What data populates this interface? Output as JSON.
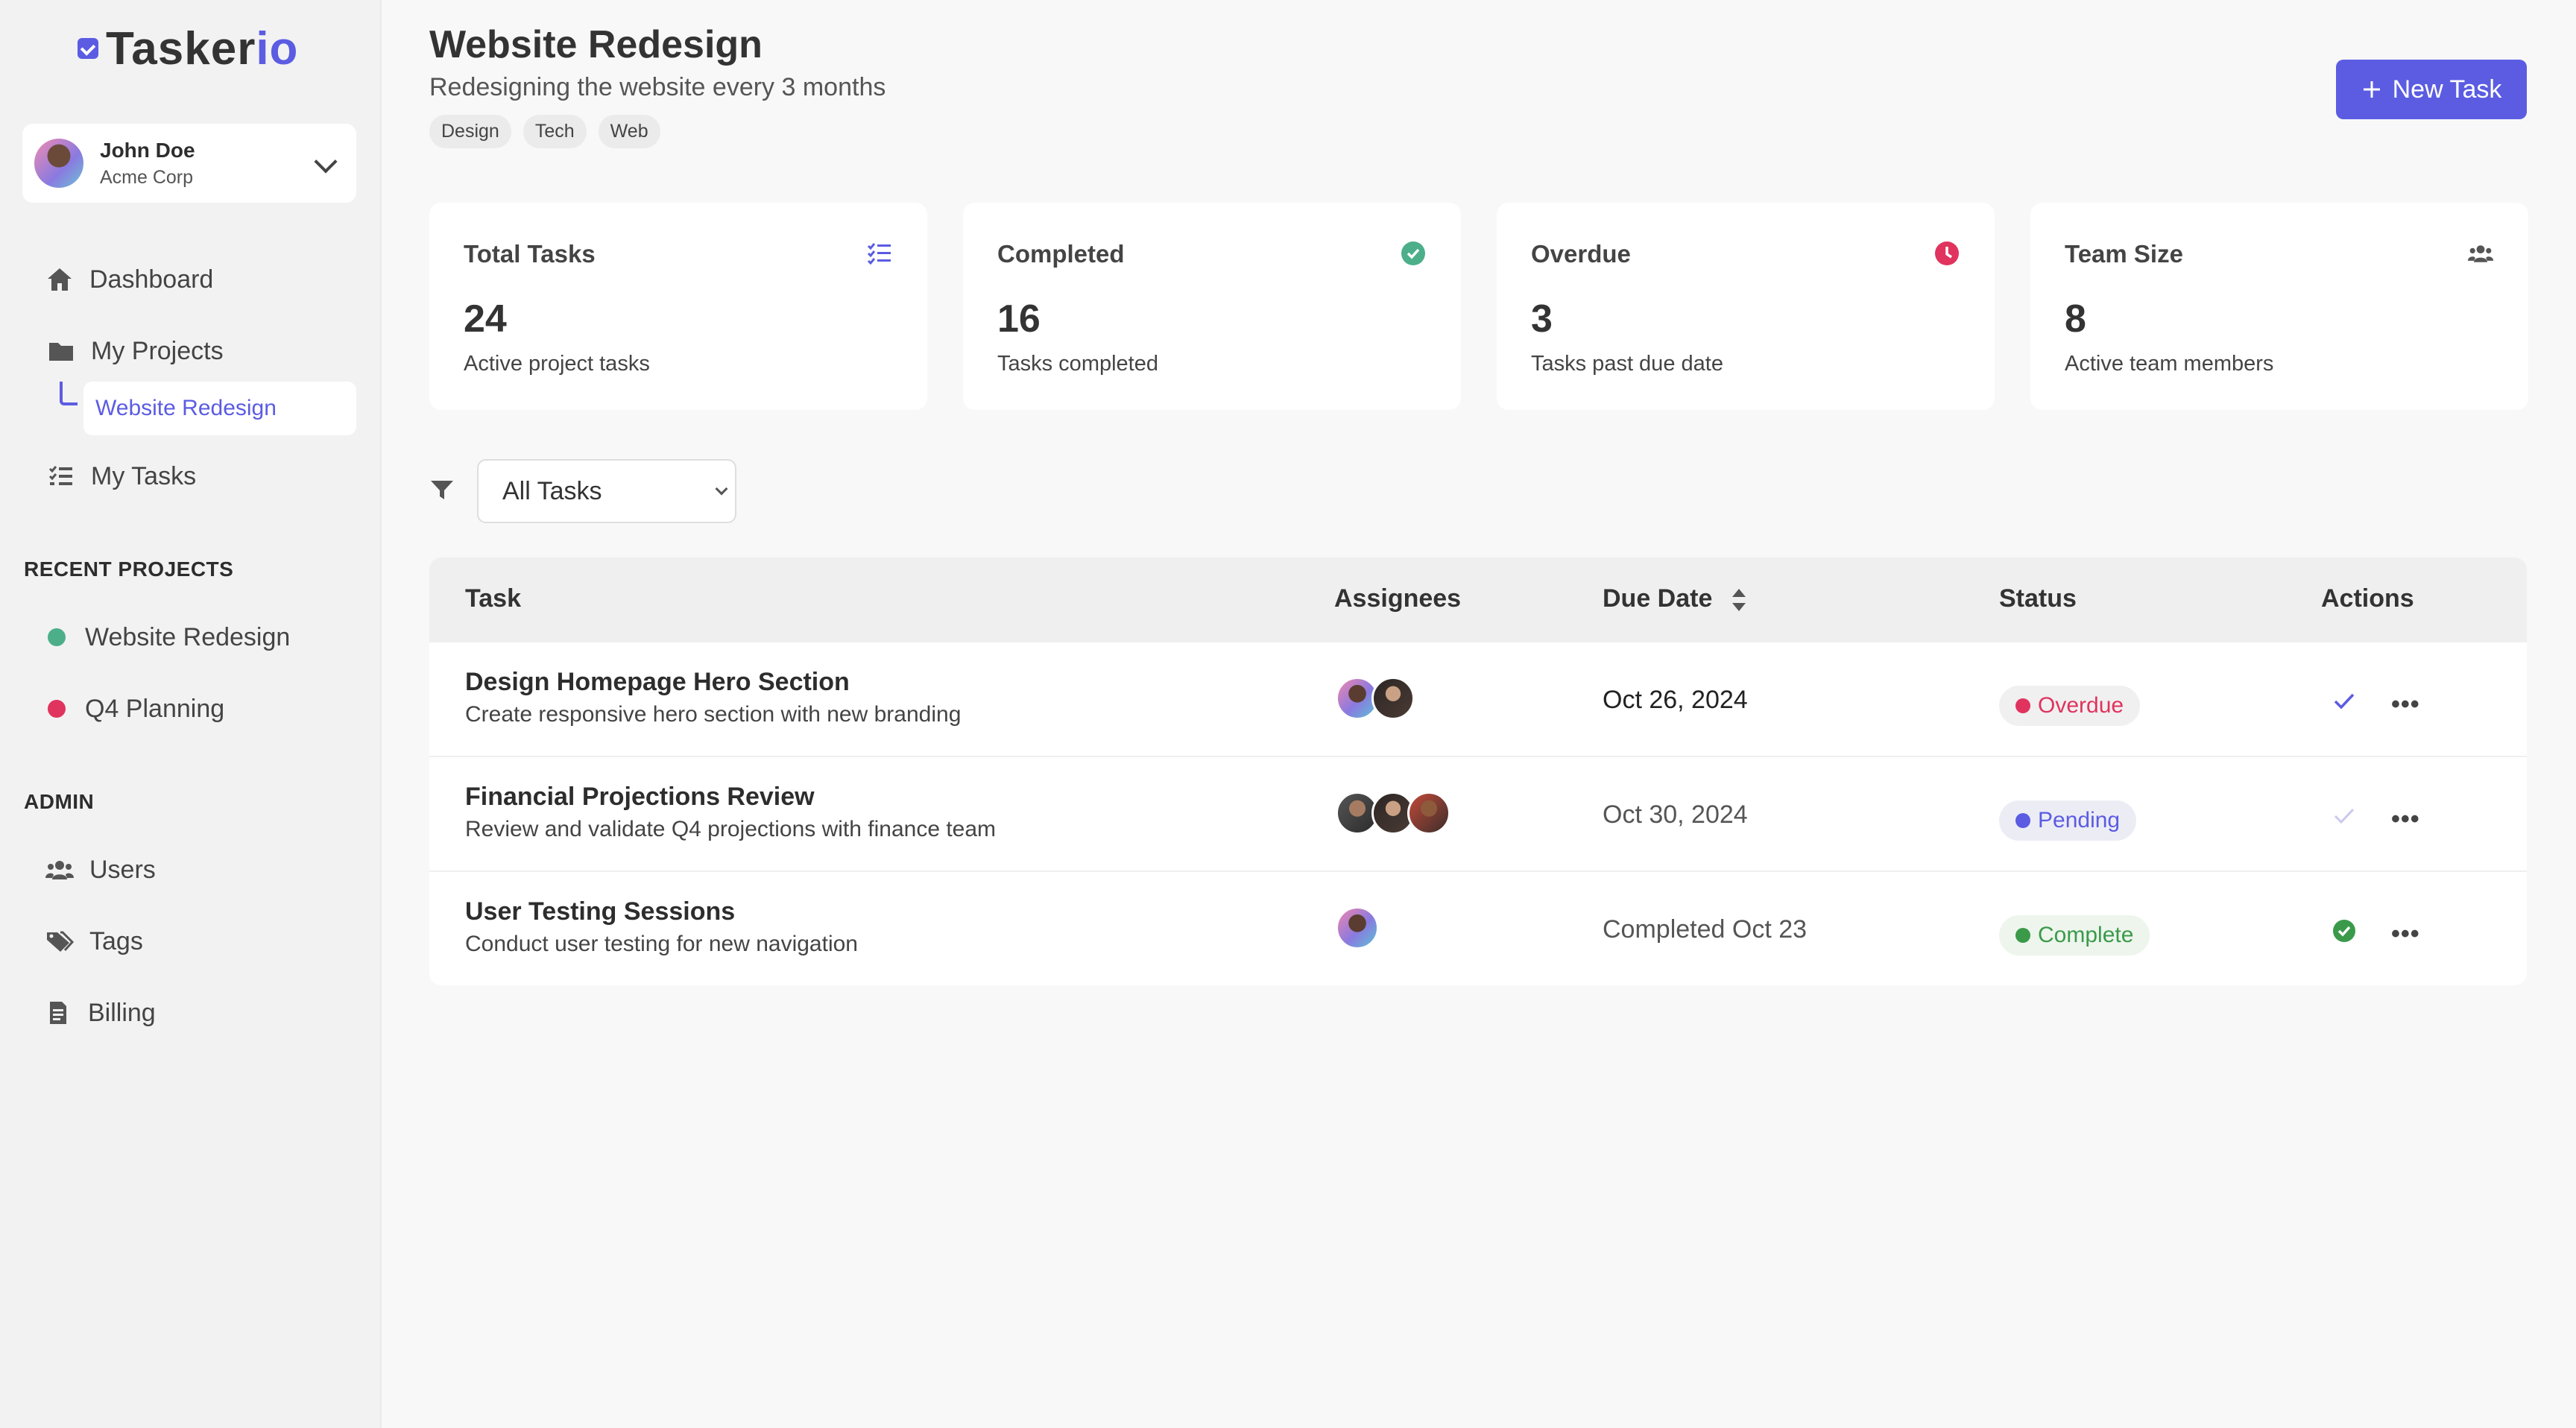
{
  "app": {
    "logo_main": "Tasker",
    "logo_accent": "io"
  },
  "user": {
    "name": "John Doe",
    "org": "Acme Corp"
  },
  "nav": {
    "dashboard": "Dashboard",
    "projects": "My Projects",
    "projects_sub": "Website Redesign",
    "tasks": "My Tasks"
  },
  "recent": {
    "heading": "RECENT PROJECTS",
    "items": [
      {
        "label": "Website Redesign",
        "color": "#4caf8a"
      },
      {
        "label": "Q4 Planning",
        "color": "#e0335e"
      }
    ]
  },
  "admin": {
    "heading": "ADMIN",
    "users": "Users",
    "tags": "Tags",
    "billing": "Billing"
  },
  "project": {
    "title": "Website Redesign",
    "subtitle": "Redesigning the website every 3 months",
    "tags": [
      "Design",
      "Tech",
      "Web"
    ]
  },
  "actions": {
    "new_task": "New Task"
  },
  "stats": [
    {
      "label": "Total Tasks",
      "value": "24",
      "desc": "Active project tasks",
      "icon": "list-check-icon",
      "color": "#5b5ce2"
    },
    {
      "label": "Completed",
      "value": "16",
      "desc": "Tasks completed",
      "icon": "check-circle-icon",
      "color": "#4caf8a"
    },
    {
      "label": "Overdue",
      "value": "3",
      "desc": "Tasks past due date",
      "icon": "clock-icon",
      "color": "#e0335e"
    },
    {
      "label": "Team Size",
      "value": "8",
      "desc": "Active team members",
      "icon": "users-icon",
      "color": "#555555"
    }
  ],
  "filter": {
    "selected": "All Tasks"
  },
  "table": {
    "headers": {
      "task": "Task",
      "assignees": "Assignees",
      "due": "Due Date",
      "status": "Status",
      "actions": "Actions"
    },
    "rows": [
      {
        "name": "Design Homepage Hero Section",
        "desc": "Create responsive hero section with new branding",
        "due": "Oct 26, 2024",
        "status": "Overdue"
      },
      {
        "name": "Financial Projections Review",
        "desc": "Review and validate Q4 projections with finance team",
        "due": "Oct 30, 2024",
        "status": "Pending"
      },
      {
        "name": "User Testing Sessions",
        "desc": "Conduct user testing for new navigation",
        "due": "Completed Oct 23",
        "status": "Complete"
      }
    ]
  },
  "colors": {
    "accent": "#5b5ce2",
    "overdue": "#e0335e",
    "pending": "#5b5ce2",
    "complete": "#3a9a4a"
  }
}
